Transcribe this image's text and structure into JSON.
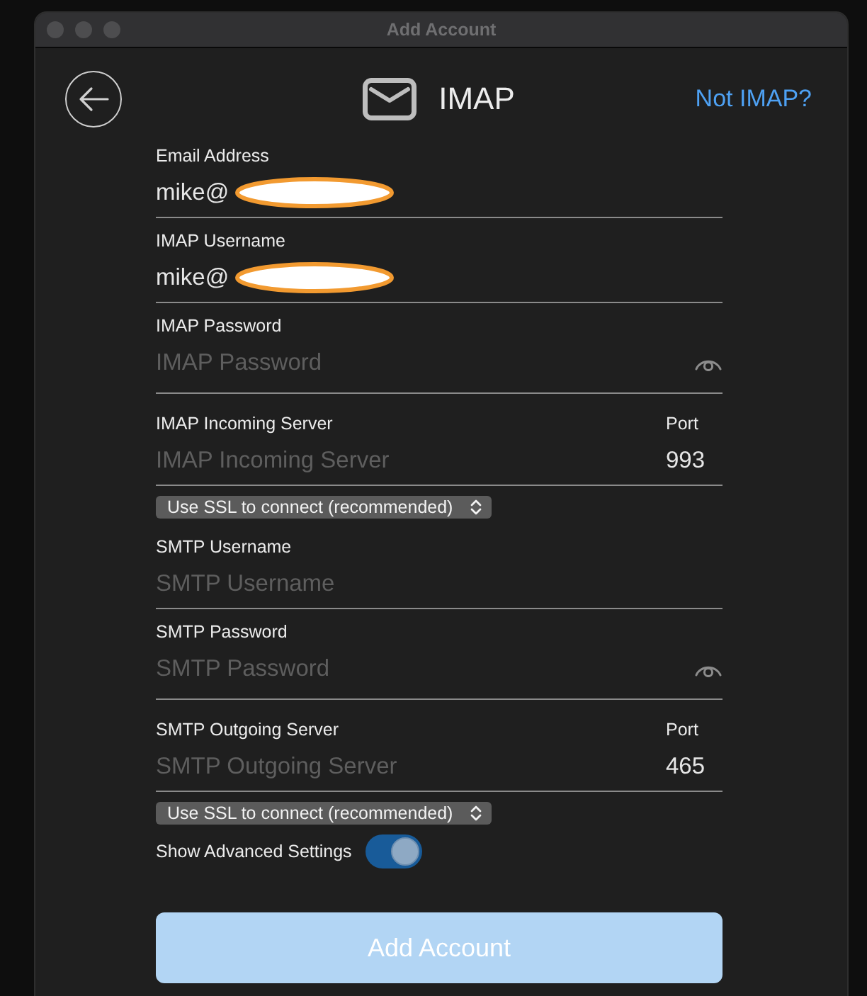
{
  "window": {
    "title": "Add Account"
  },
  "header": {
    "title": "IMAP",
    "link": "Not IMAP?"
  },
  "form": [
    {
      "kind": "field",
      "label": "Email Address",
      "value": "mike@",
      "redacted": true
    },
    {
      "kind": "field",
      "label": "IMAP Username",
      "value": "mike@",
      "redacted": true
    },
    {
      "kind": "password",
      "label": "IMAP Password",
      "placeholder": "IMAP Password"
    },
    {
      "kind": "server",
      "label": "IMAP Incoming Server",
      "placeholder": "IMAP Incoming Server",
      "port_label": "Port",
      "port": "993"
    },
    {
      "kind": "select",
      "value": "Use SSL to connect (recommended)"
    },
    {
      "kind": "field",
      "label": "SMTP Username",
      "placeholder": "SMTP Username"
    },
    {
      "kind": "password",
      "label": "SMTP Password",
      "placeholder": "SMTP Password"
    },
    {
      "kind": "server",
      "label": "SMTP Outgoing Server",
      "placeholder": "SMTP Outgoing Server",
      "port_label": "Port",
      "port": "465"
    },
    {
      "kind": "select",
      "value": "Use SSL to connect (recommended)"
    },
    {
      "kind": "toggle",
      "label": "Show Advanced Settings",
      "on": true
    }
  ],
  "submit": {
    "label": "Add Account",
    "disabled": true
  }
}
